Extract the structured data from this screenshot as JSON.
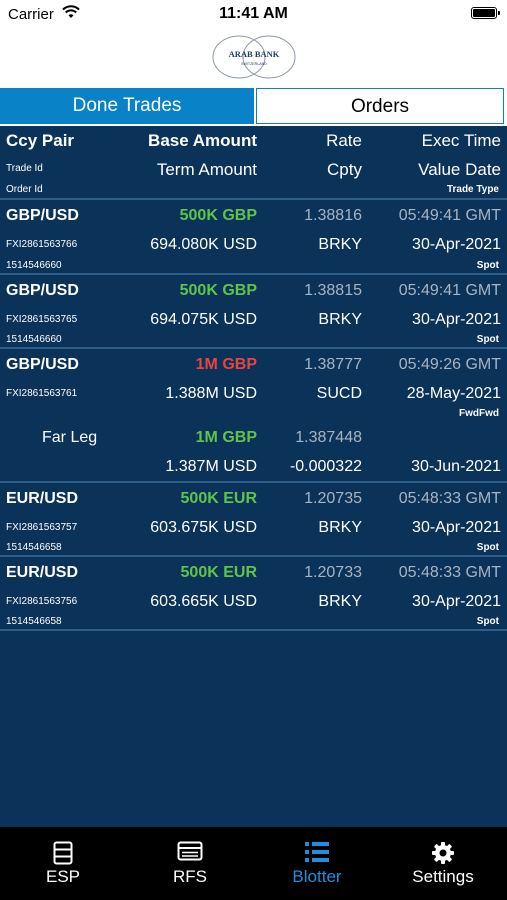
{
  "status_bar": {
    "carrier": "Carrier",
    "time": "11:41 AM"
  },
  "brand": {
    "logo_line1": "ARAB BANK",
    "logo_line2": "SWITZERLAND"
  },
  "segments": {
    "active": "Done Trades",
    "inactive": "Orders"
  },
  "header": {
    "ccy_pair": "Ccy Pair",
    "base_amount": "Base Amount",
    "rate": "Rate",
    "exec_time": "Exec Time",
    "trade_id": "Trade Id",
    "term_amount": "Term Amount",
    "cpty": "Cpty",
    "value_date": "Value Date",
    "order_id": "Order Id",
    "trade_type": "Trade Type"
  },
  "colors": {
    "background": "#0b3258",
    "accent": "#0a82c8",
    "buy": "#5fc44a",
    "sell": "#e8453c"
  },
  "trades": [
    {
      "pair": "GBP/USD",
      "base": "500K GBP",
      "base_color": "green",
      "rate": "1.38816",
      "time": "05:49:41 GMT",
      "trade_id": "FXI2861563766",
      "term": "694.080K USD",
      "cpty": "BRKY",
      "value_date": "30-Apr-2021",
      "order_id": "1514546660",
      "type": "Spot"
    },
    {
      "pair": "GBP/USD",
      "base": "500K GBP",
      "base_color": "green",
      "rate": "1.38815",
      "time": "05:49:41 GMT",
      "trade_id": "FXI2861563765",
      "term": "694.075K USD",
      "cpty": "BRKY",
      "value_date": "30-Apr-2021",
      "order_id": "1514546660",
      "type": "Spot"
    },
    {
      "pair": "GBP/USD",
      "base": "1M GBP",
      "base_color": "red",
      "rate": "1.38777",
      "time": "05:49:26 GMT",
      "trade_id": "FXI2861563761",
      "term": "1.388M USD",
      "cpty": "SUCD",
      "value_date": "28-May-2021",
      "order_id": "",
      "type": "FwdFwd",
      "far_leg": {
        "label": "Far Leg",
        "base": "1M GBP",
        "rate": "1.387448",
        "term": "1.387M USD",
        "points": "-0.000322",
        "value_date": "30-Jun-2021"
      }
    },
    {
      "pair": "EUR/USD",
      "base": "500K EUR",
      "base_color": "green",
      "rate": "1.20735",
      "time": "05:48:33 GMT",
      "trade_id": "FXI2861563757",
      "term": "603.675K USD",
      "cpty": "BRKY",
      "value_date": "30-Apr-2021",
      "order_id": "1514546658",
      "type": "Spot"
    },
    {
      "pair": "EUR/USD",
      "base": "500K EUR",
      "base_color": "green",
      "rate": "1.20733",
      "time": "05:48:33 GMT",
      "trade_id": "FXI2861563756",
      "term": "603.665K USD",
      "cpty": "BRKY",
      "value_date": "30-Apr-2021",
      "order_id": "1514546658",
      "type": "Spot"
    }
  ],
  "tabbar": [
    {
      "label": "ESP",
      "icon": "server-icon",
      "active": false
    },
    {
      "label": "RFS",
      "icon": "list-box-icon",
      "active": false
    },
    {
      "label": "Blotter",
      "icon": "bullet-list-icon",
      "active": true
    },
    {
      "label": "Settings",
      "icon": "gear-icon",
      "active": false
    }
  ]
}
